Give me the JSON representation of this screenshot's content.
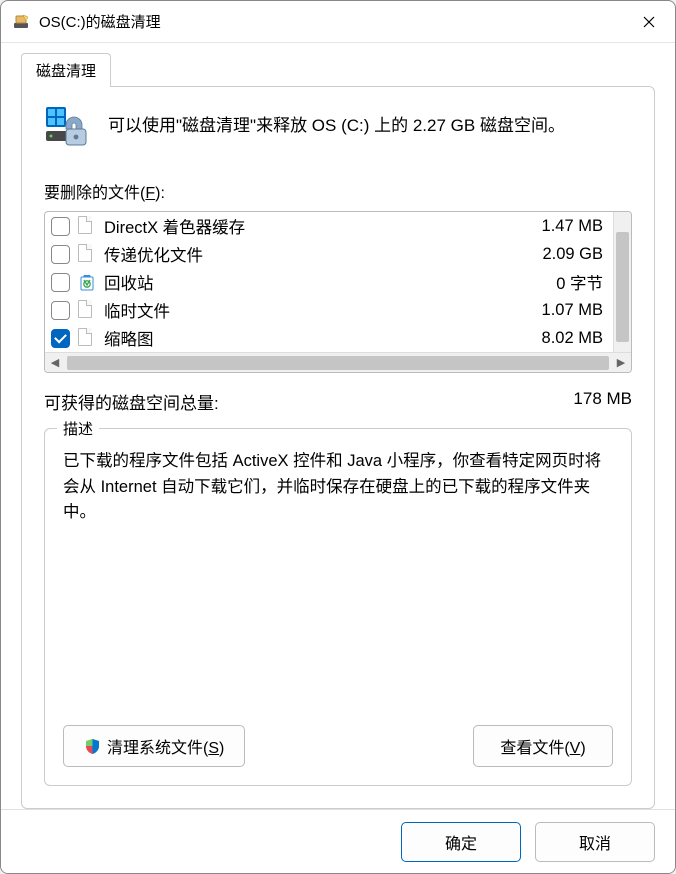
{
  "window": {
    "title": "OS(C:)的磁盘清理"
  },
  "tab": {
    "label": "磁盘清理"
  },
  "intro": {
    "text": "可以使用\"磁盘清理\"来释放 OS (C:) 上的 2.27 GB 磁盘空间。"
  },
  "files_section": {
    "label_prefix": "要删除的文件(",
    "label_hotkey": "F",
    "label_suffix": "):"
  },
  "files": [
    {
      "name": "DirectX 着色器缓存",
      "size": "1.47 MB",
      "checked": false,
      "icon": "file"
    },
    {
      "name": "传递优化文件",
      "size": "2.09 GB",
      "checked": false,
      "icon": "file"
    },
    {
      "name": "回收站",
      "size": "0 字节",
      "checked": false,
      "icon": "recycle"
    },
    {
      "name": "临时文件",
      "size": "1.07 MB",
      "checked": false,
      "icon": "file"
    },
    {
      "name": "缩略图",
      "size": "8.02 MB",
      "checked": true,
      "icon": "file"
    }
  ],
  "gain": {
    "label": "可获得的磁盘空间总量:",
    "value": "178 MB"
  },
  "description": {
    "legend": "描述",
    "text": "已下载的程序文件包括 ActiveX 控件和 Java 小程序，你查看特定网页时将会从 Internet 自动下载它们，并临时保存在硬盘上的已下载的程序文件夹中。"
  },
  "buttons": {
    "clean_system_prefix": "清理系统文件(",
    "clean_system_hotkey": "S",
    "clean_system_suffix": ")",
    "view_files_prefix": "查看文件(",
    "view_files_hotkey": "V",
    "view_files_suffix": ")",
    "ok": "确定",
    "cancel": "取消"
  }
}
